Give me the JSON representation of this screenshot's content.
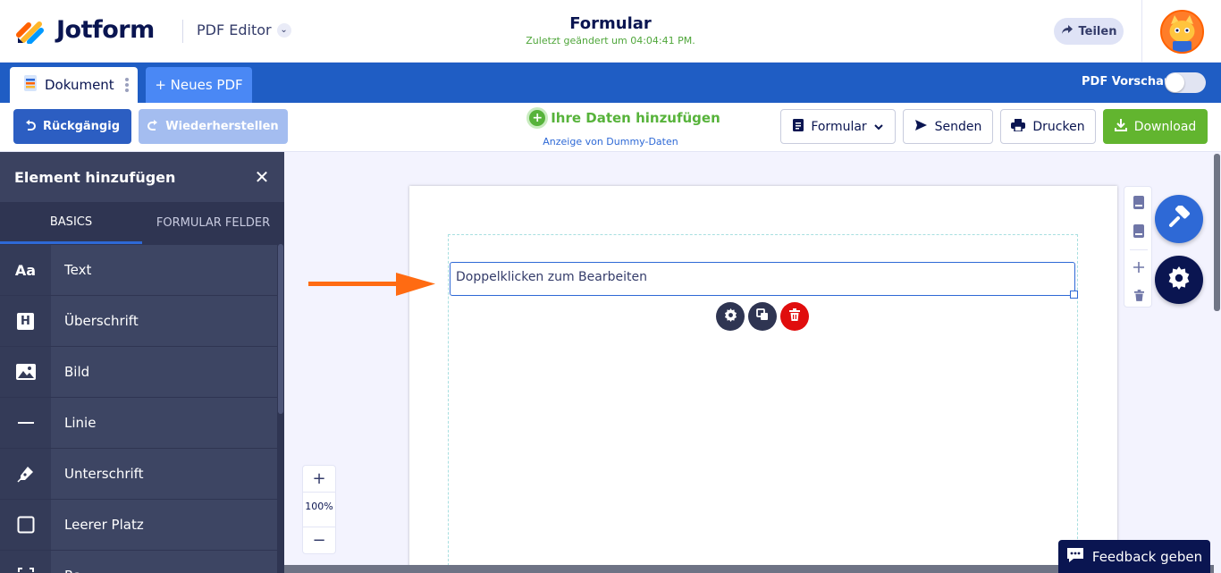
{
  "header": {
    "brand": "Jotform",
    "product": "PDF Editor",
    "title": "Formular",
    "subtitle": "Zuletzt geändert um 04:04:41 PM.",
    "share_label": "Teilen"
  },
  "tabs": {
    "document_label": "Dokument",
    "new_pdf_label": "+ Neues PDF",
    "preview_label": "PDF Vorschau",
    "preview_enabled": false
  },
  "toolbar": {
    "undo_label": "Rückgängig",
    "redo_label": "Wiederherstellen",
    "add_data_label": "Ihre Daten hinzufügen",
    "dummy_label": "Anzeige von Dummy-Daten",
    "form_label": "Formular",
    "send_label": "Senden",
    "print_label": "Drucken",
    "download_label": "Download"
  },
  "panel": {
    "title": "Element hinzufügen",
    "tabs": [
      "BASICS",
      "FORMULAR FELDER"
    ],
    "active_tab": "BASICS",
    "items": [
      {
        "icon": "Aa",
        "label": "Text"
      },
      {
        "icon": "H",
        "label": "Überschrift"
      },
      {
        "icon": "image-icon",
        "label": "Bild"
      },
      {
        "icon": "line-icon",
        "label": "Linie"
      },
      {
        "icon": "pen-icon",
        "label": "Unterschrift"
      },
      {
        "icon": "square-icon",
        "label": "Leerer Platz"
      },
      {
        "icon": "frame-icon",
        "label": "Ra"
      }
    ]
  },
  "canvas": {
    "text_element": "Doppelklicken zum Bearbeiten",
    "zoom_label": "100%",
    "zoom_in": "+",
    "zoom_out": "−"
  },
  "feedback_label": "Feedback geben",
  "colors": {
    "brand_navy": "#0a1551",
    "tab_bar_blue": "#1f5dc4",
    "download_green": "#62b52f",
    "accent_blue": "#2e69d6",
    "delete_red": "#e00d0d",
    "arrow_orange": "#ff6b12"
  }
}
